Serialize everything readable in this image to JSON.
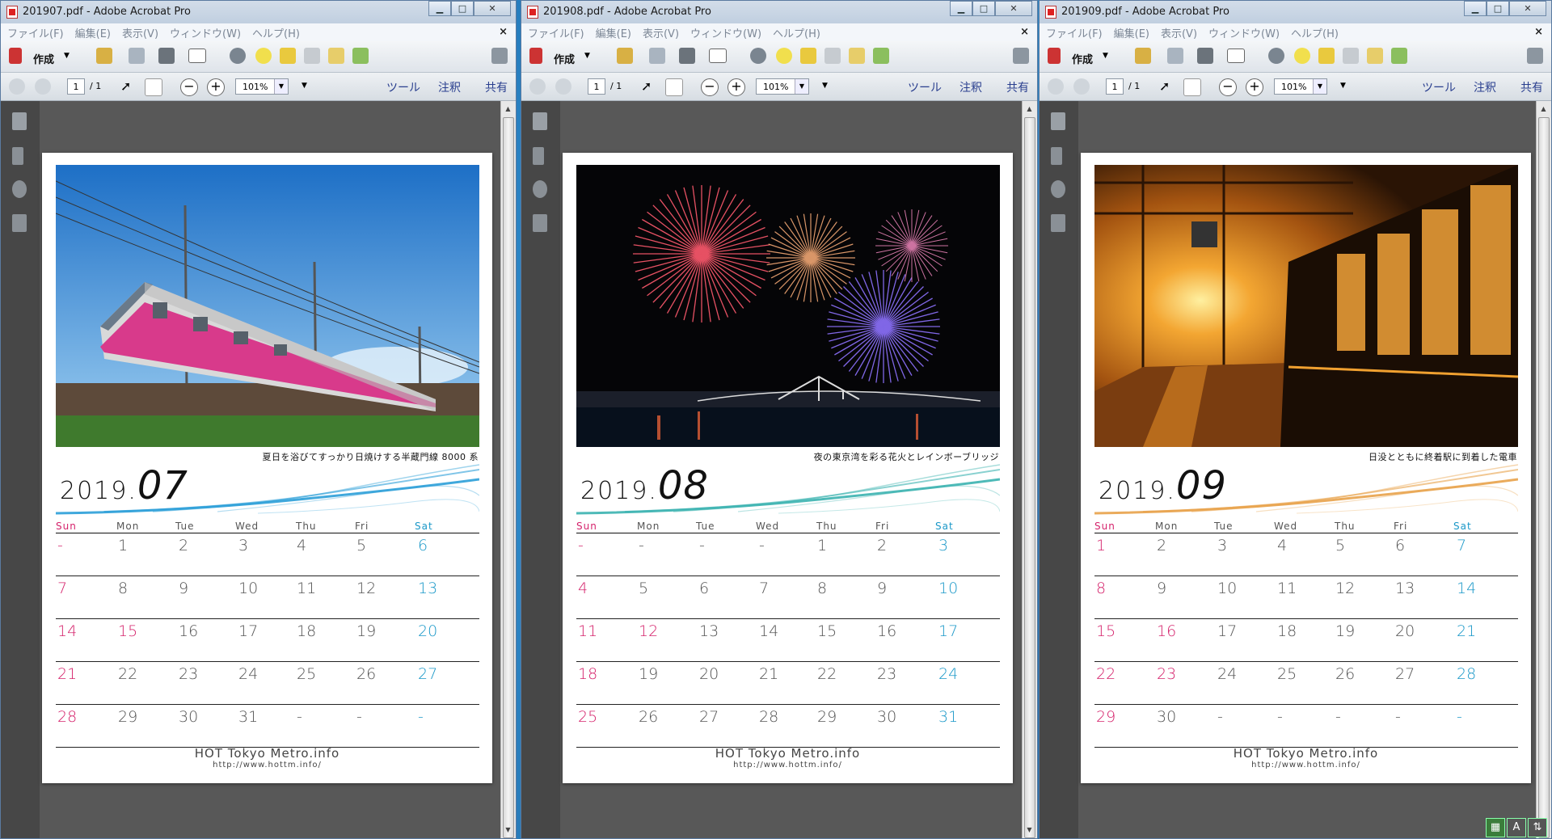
{
  "menu_labels": [
    "ファイル(F)",
    "編集(E)",
    "表示(V)",
    "ウィンドウ(W)",
    "ヘルプ(H)"
  ],
  "dow_labels": [
    "Sun",
    "Mon",
    "Tue",
    "Wed",
    "Thu",
    "Fri",
    "Sat"
  ],
  "toolbar": {
    "create_label": "作成",
    "page_current": "1",
    "page_total": "/ 1",
    "zoom": "101%",
    "tools_label": "ツール",
    "comment_label": "注釈",
    "share_label": "共有"
  },
  "footer": {
    "name": "HOT Tokyo Metro.info",
    "url": "http://www.hottm.info/"
  },
  "windows": [
    {
      "title": "201907.pdf - Adobe Acrobat Pro",
      "active": false,
      "year": "2019.",
      "month": "07",
      "caption": "夏日を浴びてすっかり日焼けする半蔵門線 8000 系",
      "weeks": [
        [
          "-",
          "1",
          "2",
          "3",
          "4",
          "5",
          "6"
        ],
        [
          "7",
          "8",
          "9",
          "10",
          "11",
          "12",
          "13"
        ],
        [
          "14",
          "15",
          "16",
          "17",
          "18",
          "19",
          "20"
        ],
        [
          "21",
          "22",
          "23",
          "24",
          "25",
          "26",
          "27"
        ],
        [
          "28",
          "29",
          "30",
          "31",
          "-",
          "-",
          "-"
        ]
      ],
      "holidays": [
        "15"
      ]
    },
    {
      "title": "201908.pdf - Adobe Acrobat Pro",
      "active": false,
      "year": "2019.",
      "month": "08",
      "caption": "夜の東京湾を彩る花火とレインボーブリッジ",
      "weeks": [
        [
          "-",
          "-",
          "-",
          "-",
          "1",
          "2",
          "3"
        ],
        [
          "4",
          "5",
          "6",
          "7",
          "8",
          "9",
          "10"
        ],
        [
          "11",
          "12",
          "13",
          "14",
          "15",
          "16",
          "17"
        ],
        [
          "18",
          "19",
          "20",
          "21",
          "22",
          "23",
          "24"
        ],
        [
          "25",
          "26",
          "27",
          "28",
          "29",
          "30",
          "31"
        ]
      ],
      "holidays": [
        "12"
      ]
    },
    {
      "title": "201909.pdf - Adobe Acrobat Pro",
      "active": false,
      "year": "2019.",
      "month": "09",
      "caption": "日没とともに終着駅に到着した電車",
      "weeks": [
        [
          "1",
          "2",
          "3",
          "4",
          "5",
          "6",
          "7"
        ],
        [
          "8",
          "9",
          "10",
          "11",
          "12",
          "13",
          "14"
        ],
        [
          "15",
          "16",
          "17",
          "18",
          "19",
          "20",
          "21"
        ],
        [
          "22",
          "23",
          "24",
          "25",
          "26",
          "27",
          "28"
        ],
        [
          "29",
          "30",
          "-",
          "-",
          "-",
          "-",
          "-"
        ]
      ],
      "holidays": [
        "16",
        "23"
      ]
    }
  ],
  "colors": {
    "sunday": "#d5226b",
    "saturday": "#1a98c8",
    "wave_july": "#2b9fd8",
    "wave_august": "#3bb3b0",
    "wave_september": "#e8a24a"
  }
}
